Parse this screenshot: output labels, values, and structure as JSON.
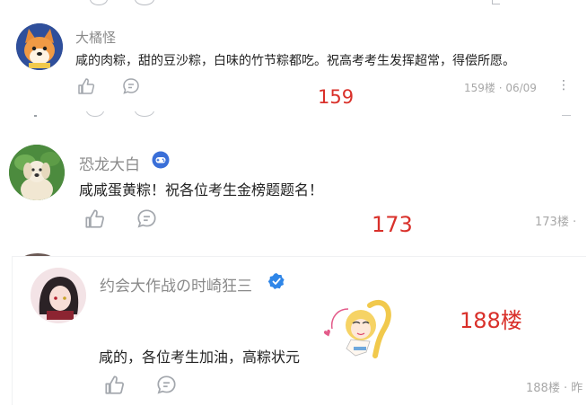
{
  "comments": [
    {
      "nickname": "大橘怪",
      "text": "咸的肉粽，甜的豆沙粽，白味的竹节粽都吃。祝高考考生发挥超常，得偿所愿。",
      "floor": "159楼 · 06/09",
      "more": "⋮",
      "annotation": "159"
    },
    {
      "nickname": "恐龙大白",
      "text": "咸咸蛋黄粽！祝各位考生金榜题题名！",
      "floor": "173楼 ·",
      "annotation": "173"
    },
    {
      "nickname": "约会大作战の时崎狂三",
      "text": "咸的，各位考生加油，高粽状元",
      "floor": "188楼 · 昨",
      "annotation": "188楼"
    }
  ],
  "colors": {
    "annotation": "#d9302a",
    "badge_gamepad": "#3a6fd8",
    "badge_verified": "#2f86e8"
  }
}
